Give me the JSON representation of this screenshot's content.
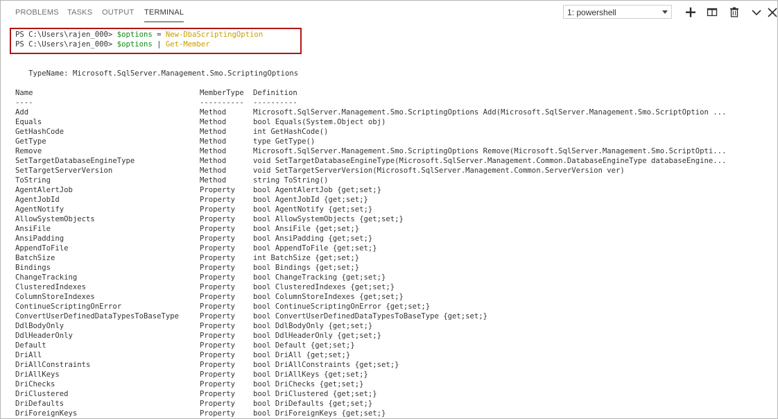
{
  "tabs": [
    {
      "label": "PROBLEMS",
      "active": false
    },
    {
      "label": "TASKS",
      "active": false
    },
    {
      "label": "OUTPUT",
      "active": false
    },
    {
      "label": "TERMINAL",
      "active": true
    }
  ],
  "terminal_select": {
    "value": "1: powershell"
  },
  "actions": [
    {
      "icon": "plus-icon",
      "label": "New Terminal"
    },
    {
      "icon": "split-icon",
      "label": "Split Terminal"
    },
    {
      "icon": "trash-icon",
      "label": "Kill Terminal"
    },
    {
      "icon": "chevron-up-icon",
      "label": "Maximize Panel"
    },
    {
      "icon": "close-icon",
      "label": "Close Panel"
    }
  ],
  "colors": {
    "highlight_border": "#b01515",
    "variable": "#0f8a0f",
    "command": "#c5a000"
  },
  "commands": [
    {
      "prompt": "PS C:\\Users\\rajen_000> ",
      "var": "$options",
      "op": " = ",
      "cmd": "New-DbaScriptingOption"
    },
    {
      "prompt": "PS C:\\Users\\rajen_000> ",
      "var": "$options",
      "op": " | ",
      "cmd": "Get-Member"
    }
  ],
  "typename": "   TypeName: Microsoft.SqlServer.Management.Smo.ScriptingOptions",
  "table_header": {
    "name": "Name",
    "membertype": "MemberType",
    "definition": "Definition"
  },
  "table_dashes": {
    "name": "----",
    "membertype": "----------",
    "definition": "----------"
  },
  "members": [
    {
      "name": "Add",
      "type": "Method",
      "def": "Microsoft.SqlServer.Management.Smo.ScriptingOptions Add(Microsoft.SqlServer.Management.Smo.ScriptOption ..."
    },
    {
      "name": "Equals",
      "type": "Method",
      "def": "bool Equals(System.Object obj)"
    },
    {
      "name": "GetHashCode",
      "type": "Method",
      "def": "int GetHashCode()"
    },
    {
      "name": "GetType",
      "type": "Method",
      "def": "type GetType()"
    },
    {
      "name": "Remove",
      "type": "Method",
      "def": "Microsoft.SqlServer.Management.Smo.ScriptingOptions Remove(Microsoft.SqlServer.Management.Smo.ScriptOpti..."
    },
    {
      "name": "SetTargetDatabaseEngineType",
      "type": "Method",
      "def": "void SetTargetDatabaseEngineType(Microsoft.SqlServer.Management.Common.DatabaseEngineType databaseEngine..."
    },
    {
      "name": "SetTargetServerVersion",
      "type": "Method",
      "def": "void SetTargetServerVersion(Microsoft.SqlServer.Management.Common.ServerVersion ver)"
    },
    {
      "name": "ToString",
      "type": "Method",
      "def": "string ToString()"
    },
    {
      "name": "AgentAlertJob",
      "type": "Property",
      "def": "bool AgentAlertJob {get;set;}"
    },
    {
      "name": "AgentJobId",
      "type": "Property",
      "def": "bool AgentJobId {get;set;}"
    },
    {
      "name": "AgentNotify",
      "type": "Property",
      "def": "bool AgentNotify {get;set;}"
    },
    {
      "name": "AllowSystemObjects",
      "type": "Property",
      "def": "bool AllowSystemObjects {get;set;}"
    },
    {
      "name": "AnsiFile",
      "type": "Property",
      "def": "bool AnsiFile {get;set;}"
    },
    {
      "name": "AnsiPadding",
      "type": "Property",
      "def": "bool AnsiPadding {get;set;}"
    },
    {
      "name": "AppendToFile",
      "type": "Property",
      "def": "bool AppendToFile {get;set;}"
    },
    {
      "name": "BatchSize",
      "type": "Property",
      "def": "int BatchSize {get;set;}"
    },
    {
      "name": "Bindings",
      "type": "Property",
      "def": "bool Bindings {get;set;}"
    },
    {
      "name": "ChangeTracking",
      "type": "Property",
      "def": "bool ChangeTracking {get;set;}"
    },
    {
      "name": "ClusteredIndexes",
      "type": "Property",
      "def": "bool ClusteredIndexes {get;set;}"
    },
    {
      "name": "ColumnStoreIndexes",
      "type": "Property",
      "def": "bool ColumnStoreIndexes {get;set;}"
    },
    {
      "name": "ContinueScriptingOnError",
      "type": "Property",
      "def": "bool ContinueScriptingOnError {get;set;}"
    },
    {
      "name": "ConvertUserDefinedDataTypesToBaseType",
      "type": "Property",
      "def": "bool ConvertUserDefinedDataTypesToBaseType {get;set;}"
    },
    {
      "name": "DdlBodyOnly",
      "type": "Property",
      "def": "bool DdlBodyOnly {get;set;}"
    },
    {
      "name": "DdlHeaderOnly",
      "type": "Property",
      "def": "bool DdlHeaderOnly {get;set;}"
    },
    {
      "name": "Default",
      "type": "Property",
      "def": "bool Default {get;set;}"
    },
    {
      "name": "DriAll",
      "type": "Property",
      "def": "bool DriAll {get;set;}"
    },
    {
      "name": "DriAllConstraints",
      "type": "Property",
      "def": "bool DriAllConstraints {get;set;}"
    },
    {
      "name": "DriAllKeys",
      "type": "Property",
      "def": "bool DriAllKeys {get;set;}"
    },
    {
      "name": "DriChecks",
      "type": "Property",
      "def": "bool DriChecks {get;set;}"
    },
    {
      "name": "DriClustered",
      "type": "Property",
      "def": "bool DriClustered {get;set;}"
    },
    {
      "name": "DriDefaults",
      "type": "Property",
      "def": "bool DriDefaults {get;set;}"
    },
    {
      "name": "DriForeignKeys",
      "type": "Property",
      "def": "bool DriForeignKeys {get;set;}"
    }
  ]
}
